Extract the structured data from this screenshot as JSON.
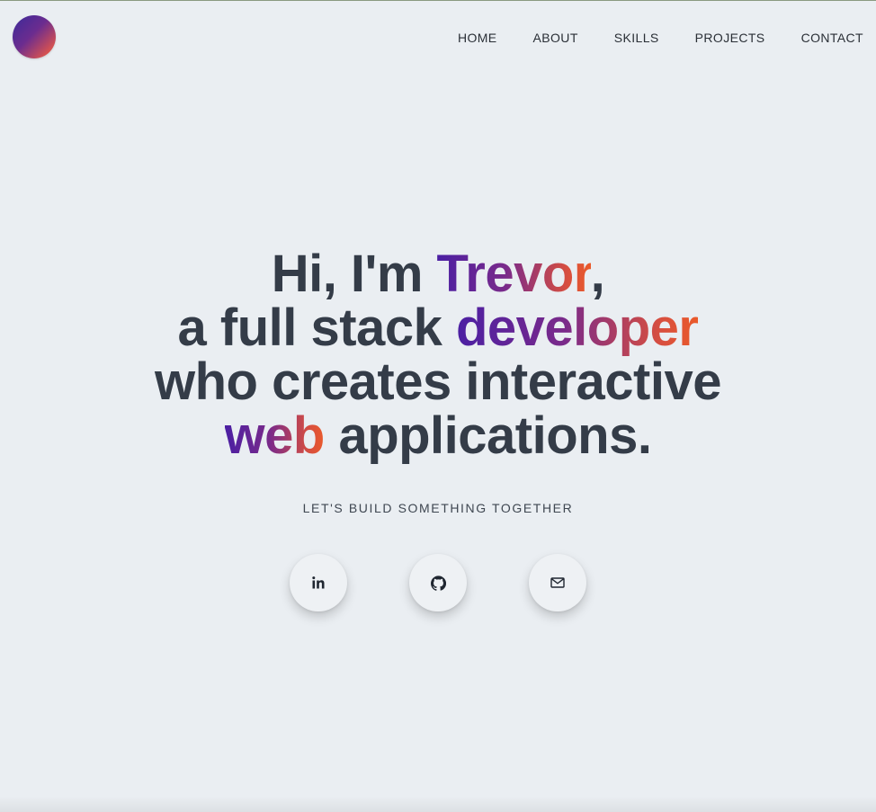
{
  "nav": {
    "items": [
      {
        "label": "HOME"
      },
      {
        "label": "ABOUT"
      },
      {
        "label": "SKILLS"
      },
      {
        "label": "PROJECTS"
      },
      {
        "label": "CONTACT"
      }
    ]
  },
  "hero": {
    "line1_prefix": "Hi, I'm ",
    "line1_name": "Trevor",
    "line1_suffix": ",",
    "line2_prefix": "a full stack ",
    "line2_highlight": "developer",
    "line3": "who creates interactive",
    "line4_highlight": "web",
    "line4_suffix": " applications.",
    "tagline": "LET'S BUILD SOMETHING TOGETHER"
  },
  "socials": [
    {
      "icon": "linkedin-icon"
    },
    {
      "icon": "github-icon"
    },
    {
      "icon": "mail-icon"
    }
  ],
  "colors": {
    "background": "#eaeef2",
    "text": "#343c48",
    "gradient_start": "#4b1fa3",
    "gradient_end": "#ea5a2a"
  }
}
